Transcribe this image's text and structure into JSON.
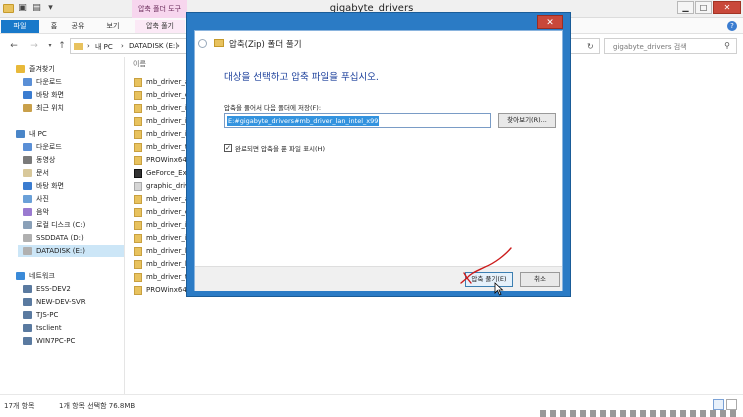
{
  "explorer": {
    "window_title": "gigabyte_drivers",
    "context_tab_label": "압축 폴더 도구",
    "ribbon_tabs": [
      "파일",
      "홈",
      "공유",
      "보기",
      "압축 풀기"
    ],
    "caption_buttons": [
      "minimize",
      "maximize",
      "close"
    ],
    "address": {
      "crumbs": [
        "내 PC",
        "DATADISK (E:)"
      ]
    },
    "search_placeholder": "gigabyte_drivers 검색",
    "column_header": "이름",
    "nav": {
      "favorites_label": "즐겨찾기",
      "favorites": [
        "다운로드",
        "바탕 화면",
        "최근 위치"
      ],
      "pc_label": "내 PC",
      "pc_items": [
        "다운로드",
        "동영상",
        "문서",
        "바탕 화면",
        "사진",
        "음악",
        "로컬 디스크 (C:)",
        "SSDDATA (D:)",
        "DATADISK (E:)"
      ],
      "network_label": "네트워크",
      "network_items": [
        "ESS-DEV2",
        "NEW-DEV-SVR",
        "TJS-PC",
        "tsclient",
        "WIN7PC-PC"
      ]
    },
    "files": [
      "mb_driver_a",
      "mb_driver_c",
      "mb_driver_i",
      "mb_driver_ir",
      "mb_driver_ir",
      "mb_driver_tl",
      "PROWinx64",
      "GeForce_Exp",
      "graphic_driv",
      "mb_driver_a",
      "mb_driver_c",
      "mb_driver_ir",
      "mb_driver_ir",
      "mb_driver_la",
      "mb_driver_la",
      "mb_driver_tl",
      "PROWinx64"
    ],
    "status": {
      "count": "17개 항목",
      "selected": "1개 항목 선택함 76.8MB"
    }
  },
  "dialog": {
    "title": "압축(Zip) 폴더 풀기",
    "heading": "대상을 선택하고 압축 파일을 푸십시오.",
    "dest_label": "압축을 풀어서 다음 폴더에 저장(F):",
    "dest_value": "E:#gigabyte_drivers#mb_driver_lan_intel_x99",
    "browse_label": "찾아보기(R)...",
    "show_files_label": "완료되면 압축을 푼 파일 표시(H)",
    "show_files_checked": true,
    "extract_label": "압축 풀기(E)",
    "cancel_label": "취소"
  },
  "colors": {
    "dialog_frame": "#2b7bc5",
    "heading_blue": "#1a3e9a",
    "selection": "#3393df",
    "annotation_red": "#cc1c1c",
    "file_tab": "#1979ca"
  }
}
